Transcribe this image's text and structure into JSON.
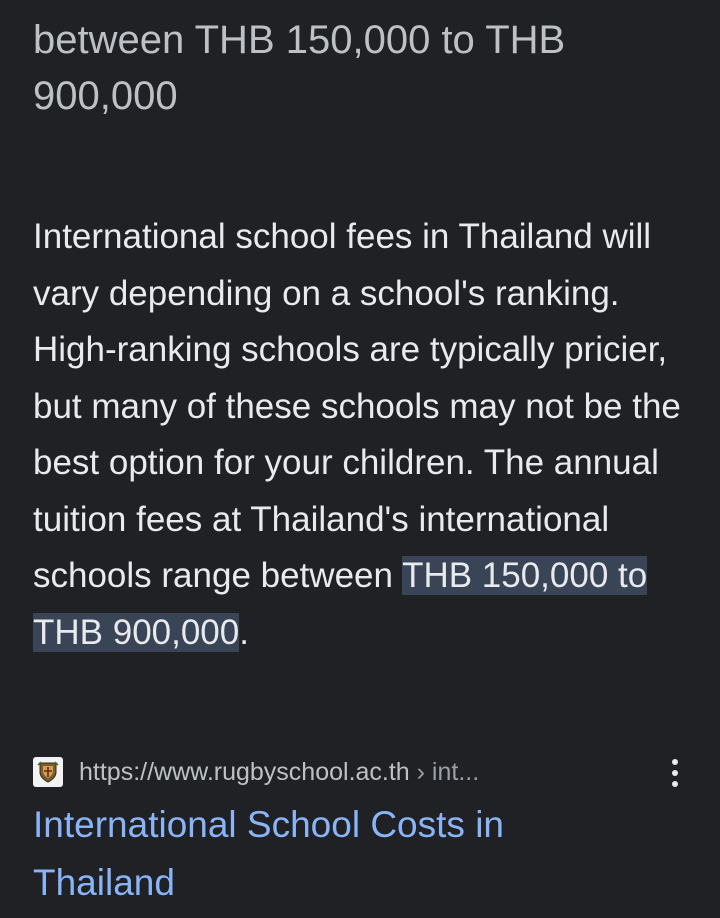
{
  "answer": {
    "title": "between THB 150,000 to THB 900,000"
  },
  "snippet": {
    "text_before": "International school fees in Thailand will vary depending on a school's ranking. High-ranking schools are typically pricier, but many of these schools may not be the best option for your children. The annual tuition fees at Thailand's international schools range between ",
    "highlight": "THB 150,000 to THB 900,000",
    "text_after": "."
  },
  "source": {
    "favicon": "school-crest-icon",
    "url": "https://www.rugbyschool.ac.th",
    "breadcrumb": " › int..."
  },
  "result": {
    "title": "International School Costs in Thailand"
  },
  "colors": {
    "background": "#202124",
    "text": "#e8eaed",
    "link": "#8ab4f8",
    "highlight": "#394457"
  }
}
